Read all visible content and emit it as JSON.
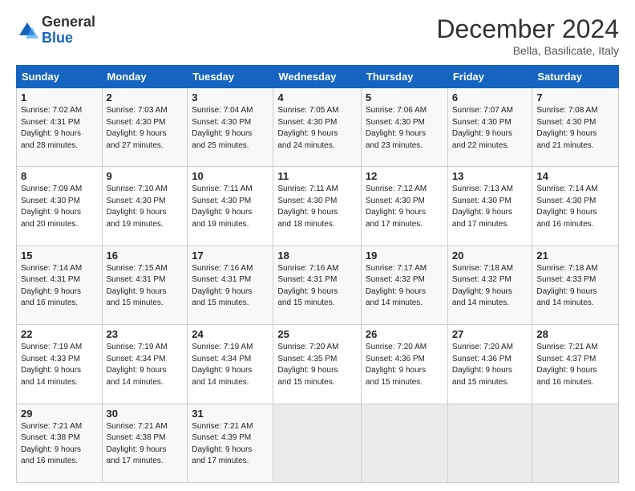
{
  "header": {
    "logo_general": "General",
    "logo_blue": "Blue",
    "month_title": "December 2024",
    "location": "Bella, Basilicate, Italy"
  },
  "weekdays": [
    "Sunday",
    "Monday",
    "Tuesday",
    "Wednesday",
    "Thursday",
    "Friday",
    "Saturday"
  ],
  "weeks": [
    [
      {
        "day": "1",
        "info": "Sunrise: 7:02 AM\nSunset: 4:31 PM\nDaylight: 9 hours\nand 28 minutes."
      },
      {
        "day": "2",
        "info": "Sunrise: 7:03 AM\nSunset: 4:30 PM\nDaylight: 9 hours\nand 27 minutes."
      },
      {
        "day": "3",
        "info": "Sunrise: 7:04 AM\nSunset: 4:30 PM\nDaylight: 9 hours\nand 25 minutes."
      },
      {
        "day": "4",
        "info": "Sunrise: 7:05 AM\nSunset: 4:30 PM\nDaylight: 9 hours\nand 24 minutes."
      },
      {
        "day": "5",
        "info": "Sunrise: 7:06 AM\nSunset: 4:30 PM\nDaylight: 9 hours\nand 23 minutes."
      },
      {
        "day": "6",
        "info": "Sunrise: 7:07 AM\nSunset: 4:30 PM\nDaylight: 9 hours\nand 22 minutes."
      },
      {
        "day": "7",
        "info": "Sunrise: 7:08 AM\nSunset: 4:30 PM\nDaylight: 9 hours\nand 21 minutes."
      }
    ],
    [
      {
        "day": "8",
        "info": "Sunrise: 7:09 AM\nSunset: 4:30 PM\nDaylight: 9 hours\nand 20 minutes."
      },
      {
        "day": "9",
        "info": "Sunrise: 7:10 AM\nSunset: 4:30 PM\nDaylight: 9 hours\nand 19 minutes."
      },
      {
        "day": "10",
        "info": "Sunrise: 7:11 AM\nSunset: 4:30 PM\nDaylight: 9 hours\nand 19 minutes."
      },
      {
        "day": "11",
        "info": "Sunrise: 7:11 AM\nSunset: 4:30 PM\nDaylight: 9 hours\nand 18 minutes."
      },
      {
        "day": "12",
        "info": "Sunrise: 7:12 AM\nSunset: 4:30 PM\nDaylight: 9 hours\nand 17 minutes."
      },
      {
        "day": "13",
        "info": "Sunrise: 7:13 AM\nSunset: 4:30 PM\nDaylight: 9 hours\nand 17 minutes."
      },
      {
        "day": "14",
        "info": "Sunrise: 7:14 AM\nSunset: 4:30 PM\nDaylight: 9 hours\nand 16 minutes."
      }
    ],
    [
      {
        "day": "15",
        "info": "Sunrise: 7:14 AM\nSunset: 4:31 PM\nDaylight: 9 hours\nand 16 minutes."
      },
      {
        "day": "16",
        "info": "Sunrise: 7:15 AM\nSunset: 4:31 PM\nDaylight: 9 hours\nand 15 minutes."
      },
      {
        "day": "17",
        "info": "Sunrise: 7:16 AM\nSunset: 4:31 PM\nDaylight: 9 hours\nand 15 minutes."
      },
      {
        "day": "18",
        "info": "Sunrise: 7:16 AM\nSunset: 4:31 PM\nDaylight: 9 hours\nand 15 minutes."
      },
      {
        "day": "19",
        "info": "Sunrise: 7:17 AM\nSunset: 4:32 PM\nDaylight: 9 hours\nand 14 minutes."
      },
      {
        "day": "20",
        "info": "Sunrise: 7:18 AM\nSunset: 4:32 PM\nDaylight: 9 hours\nand 14 minutes."
      },
      {
        "day": "21",
        "info": "Sunrise: 7:18 AM\nSunset: 4:33 PM\nDaylight: 9 hours\nand 14 minutes."
      }
    ],
    [
      {
        "day": "22",
        "info": "Sunrise: 7:19 AM\nSunset: 4:33 PM\nDaylight: 9 hours\nand 14 minutes."
      },
      {
        "day": "23",
        "info": "Sunrise: 7:19 AM\nSunset: 4:34 PM\nDaylight: 9 hours\nand 14 minutes."
      },
      {
        "day": "24",
        "info": "Sunrise: 7:19 AM\nSunset: 4:34 PM\nDaylight: 9 hours\nand 14 minutes."
      },
      {
        "day": "25",
        "info": "Sunrise: 7:20 AM\nSunset: 4:35 PM\nDaylight: 9 hours\nand 15 minutes."
      },
      {
        "day": "26",
        "info": "Sunrise: 7:20 AM\nSunset: 4:36 PM\nDaylight: 9 hours\nand 15 minutes."
      },
      {
        "day": "27",
        "info": "Sunrise: 7:20 AM\nSunset: 4:36 PM\nDaylight: 9 hours\nand 15 minutes."
      },
      {
        "day": "28",
        "info": "Sunrise: 7:21 AM\nSunset: 4:37 PM\nDaylight: 9 hours\nand 16 minutes."
      }
    ],
    [
      {
        "day": "29",
        "info": "Sunrise: 7:21 AM\nSunset: 4:38 PM\nDaylight: 9 hours\nand 16 minutes."
      },
      {
        "day": "30",
        "info": "Sunrise: 7:21 AM\nSunset: 4:38 PM\nDaylight: 9 hours\nand 17 minutes."
      },
      {
        "day": "31",
        "info": "Sunrise: 7:21 AM\nSunset: 4:39 PM\nDaylight: 9 hours\nand 17 minutes."
      },
      {
        "day": "",
        "info": ""
      },
      {
        "day": "",
        "info": ""
      },
      {
        "day": "",
        "info": ""
      },
      {
        "day": "",
        "info": ""
      }
    ]
  ]
}
